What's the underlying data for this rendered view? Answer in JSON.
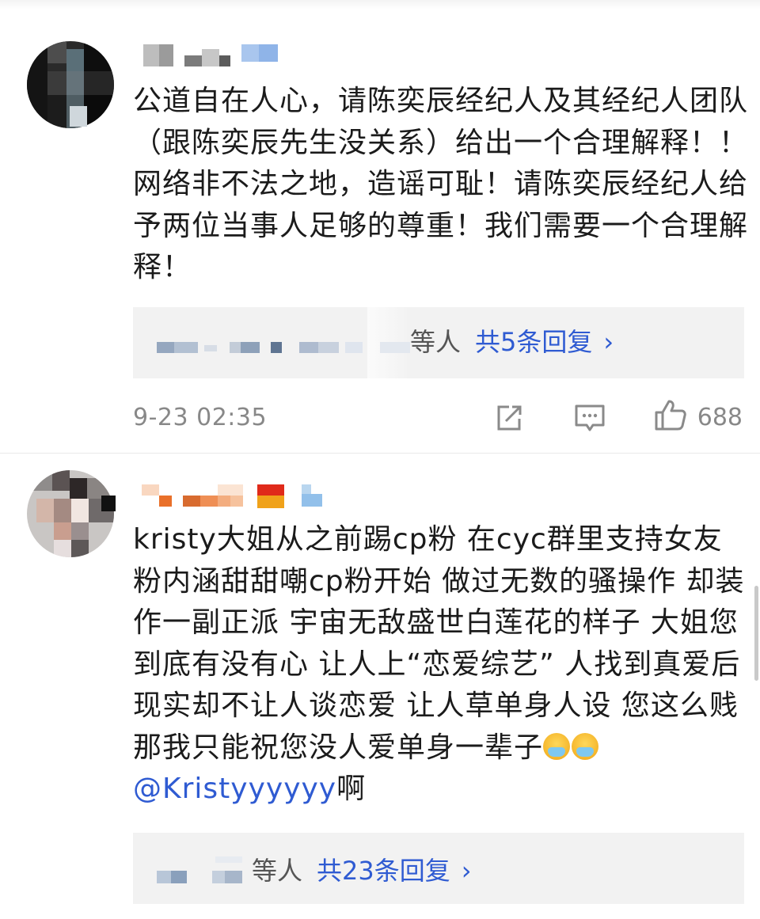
{
  "comments": [
    {
      "text": "公道自在人心，请陈奕辰经纪人及其经纪人团队（跟陈奕辰先生没关系）给出一个合理解释！！网络非不法之地，造谣可耻！请陈奕辰经纪人给予两位当事人足够的尊重！我们需要一个合理解释！",
      "reply_etc": "等人",
      "reply_count_label": "共5条回复",
      "reply_chevron": "›",
      "timestamp": "9-23 02:35",
      "like_count": "688"
    },
    {
      "text_before_mention": "kristy大姐从之前踢cp粉 在cyc群里支持女友粉内涵甜甜嘲cp粉开始 做过无数的骚操作 却装作一副正派 宇宙无敌盛世白莲花的样子 大姐您到底有没有心 让人上“恋爱综艺” 人找到真爱后现实却不让人谈恋爱 让人草单身人设 您这么贱那我只能祝您没人爱单身一辈子",
      "emoji_icons": [
        "face-with-steam-emoji",
        "face-with-steam-emoji"
      ],
      "mention": "@Kristyyyyyy",
      "text_after_mention": "啊",
      "reply_etc": "等人",
      "reply_count_label": "共23条回复",
      "reply_chevron": "›"
    }
  ],
  "icons": {
    "share": "share-icon",
    "comment": "comment-icon",
    "like": "thumbs-up-icon"
  },
  "colors": {
    "link": "#2f5bd2",
    "meta": "#888888",
    "reply_bg": "#f2f2f2"
  }
}
